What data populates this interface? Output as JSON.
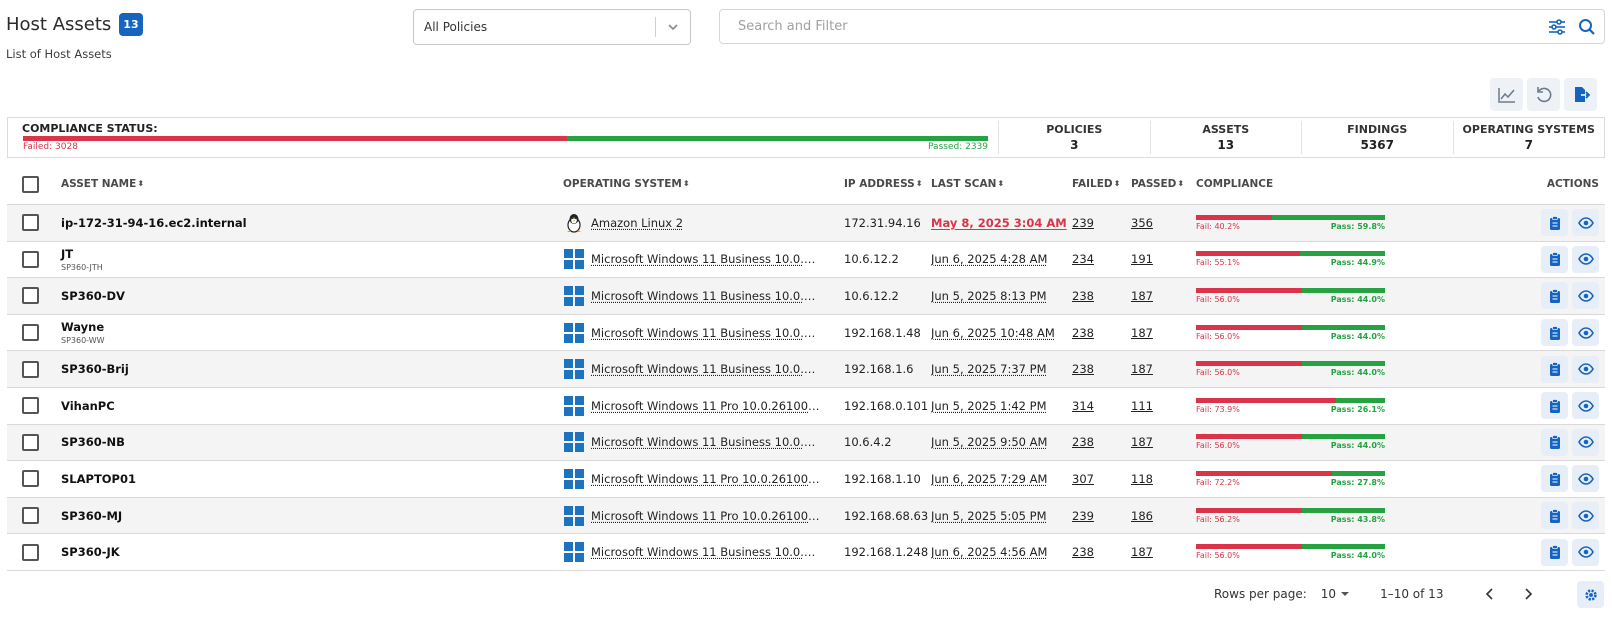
{
  "header": {
    "title": "Host Assets",
    "count": "13",
    "subtitle": "List of Host Assets"
  },
  "policy_filter": {
    "value": "All Policies"
  },
  "search": {
    "placeholder": "Search and Filter"
  },
  "toolbar": {
    "icons": [
      "chart-line-icon",
      "reset-icon",
      "export-icon"
    ]
  },
  "compliance_status": {
    "label": "COMPLIANCE STATUS:",
    "failed_label": "Failed: 3028",
    "passed_label": "Passed: 2339",
    "failed": 3028,
    "passed": 2339,
    "fail_color": "#d9344a",
    "pass_color": "#27a243"
  },
  "stats": [
    {
      "label": "POLICIES",
      "value": "3"
    },
    {
      "label": "ASSETS",
      "value": "13"
    },
    {
      "label": "FINDINGS",
      "value": "5367"
    },
    {
      "label": "OPERATING SYSTEMS",
      "value": "7"
    }
  ],
  "columns": {
    "asset_name": "ASSET NAME",
    "os": "OPERATING SYSTEM",
    "ip": "IP ADDRESS",
    "last_scan": "LAST SCAN",
    "failed": "FAILED",
    "passed": "PASSED",
    "compliance": "COMPLIANCE",
    "actions": "ACTIONS"
  },
  "rows": [
    {
      "name": "ip-172-31-94-16.ec2.internal",
      "sub": "",
      "os_icon": "linux-icon",
      "os": "Amazon Linux 2",
      "ip": "172.31.94.16",
      "last_scan": "May 8, 2025 3:04 AM",
      "scan_late": true,
      "failed": "239",
      "passed": "356",
      "fail_pct": 40.2,
      "fail_label": "Fail: 40.2%",
      "pass_label": "Pass: 59.8%"
    },
    {
      "name": "JT",
      "sub": "SP360-JTH",
      "os_icon": "windows-icon",
      "os": "Microsoft Windows 11 Business 10.0.26100...",
      "ip": "10.6.12.2",
      "last_scan": "Jun 6, 2025 4:28 AM",
      "scan_late": false,
      "failed": "234",
      "passed": "191",
      "fail_pct": 55.1,
      "fail_label": "Fail: 55.1%",
      "pass_label": "Pass: 44.9%"
    },
    {
      "name": "SP360-DV",
      "sub": "",
      "os_icon": "windows-icon",
      "os": "Microsoft Windows 11 Business 10.0.26100...",
      "ip": "10.6.12.2",
      "last_scan": "Jun 5, 2025 8:13 PM",
      "scan_late": false,
      "failed": "238",
      "passed": "187",
      "fail_pct": 56.0,
      "fail_label": "Fail: 56.0%",
      "pass_label": "Pass: 44.0%"
    },
    {
      "name": "Wayne",
      "sub": "SP360-WW",
      "os_icon": "windows-icon",
      "os": "Microsoft Windows 11 Business 10.0.26100...",
      "ip": "192.168.1.48",
      "last_scan": "Jun 6, 2025 10:48 AM",
      "scan_late": false,
      "failed": "238",
      "passed": "187",
      "fail_pct": 56.0,
      "fail_label": "Fail: 56.0%",
      "pass_label": "Pass: 44.0%"
    },
    {
      "name": "SP360-Brij",
      "sub": "",
      "os_icon": "windows-icon",
      "os": "Microsoft Windows 11 Business 10.0.26100...",
      "ip": "192.168.1.6",
      "last_scan": "Jun 5, 2025 7:37 PM",
      "scan_late": false,
      "failed": "238",
      "passed": "187",
      "fail_pct": 56.0,
      "fail_label": "Fail: 56.0%",
      "pass_label": "Pass: 44.0%"
    },
    {
      "name": "VihanPC",
      "sub": "",
      "os_icon": "windows-icon",
      "os": "Microsoft Windows 11 Pro 10.0.26100 64-b...",
      "ip": "192.168.0.101",
      "last_scan": "Jun 5, 2025 1:42 PM",
      "scan_late": false,
      "failed": "314",
      "passed": "111",
      "fail_pct": 73.9,
      "fail_label": "Fail: 73.9%",
      "pass_label": "Pass: 26.1%"
    },
    {
      "name": "SP360-NB",
      "sub": "",
      "os_icon": "windows-icon",
      "os": "Microsoft Windows 11 Business 10.0.26100...",
      "ip": "10.6.4.2",
      "last_scan": "Jun 5, 2025 9:50 AM",
      "scan_late": false,
      "failed": "238",
      "passed": "187",
      "fail_pct": 56.0,
      "fail_label": "Fail: 56.0%",
      "pass_label": "Pass: 44.0%"
    },
    {
      "name": "SLAPTOP01",
      "sub": "",
      "os_icon": "windows-icon",
      "os": "Microsoft Windows 11 Pro 10.0.26100 64-b...",
      "ip": "192.168.1.10",
      "last_scan": "Jun 6, 2025 7:29 AM",
      "scan_late": false,
      "failed": "307",
      "passed": "118",
      "fail_pct": 72.2,
      "fail_label": "Fail: 72.2%",
      "pass_label": "Pass: 27.8%"
    },
    {
      "name": "SP360-MJ",
      "sub": "",
      "os_icon": "windows-icon",
      "os": "Microsoft Windows 11 Pro 10.0.26100 64-b...",
      "ip": "192.168.68.63",
      "last_scan": "Jun 5, 2025 5:05 PM",
      "scan_late": false,
      "failed": "239",
      "passed": "186",
      "fail_pct": 56.2,
      "fail_label": "Fail: 56.2%",
      "pass_label": "Pass: 43.8%"
    },
    {
      "name": "SP360-JK",
      "sub": "",
      "os_icon": "windows-icon",
      "os": "Microsoft Windows 11 Business 10.0.26100...",
      "ip": "192.168.1.248",
      "last_scan": "Jun 6, 2025 4:56 AM",
      "scan_late": false,
      "failed": "238",
      "passed": "187",
      "fail_pct": 56.0,
      "fail_label": "Fail: 56.0%",
      "pass_label": "Pass: 44.0%"
    }
  ],
  "pagination": {
    "rows_per_page_label": "Rows per page:",
    "rows_per_page": "10",
    "range": "1–10 of 13"
  },
  "colors": {
    "accent": "#1565c0",
    "fail": "#d9344a",
    "pass": "#27a243"
  }
}
